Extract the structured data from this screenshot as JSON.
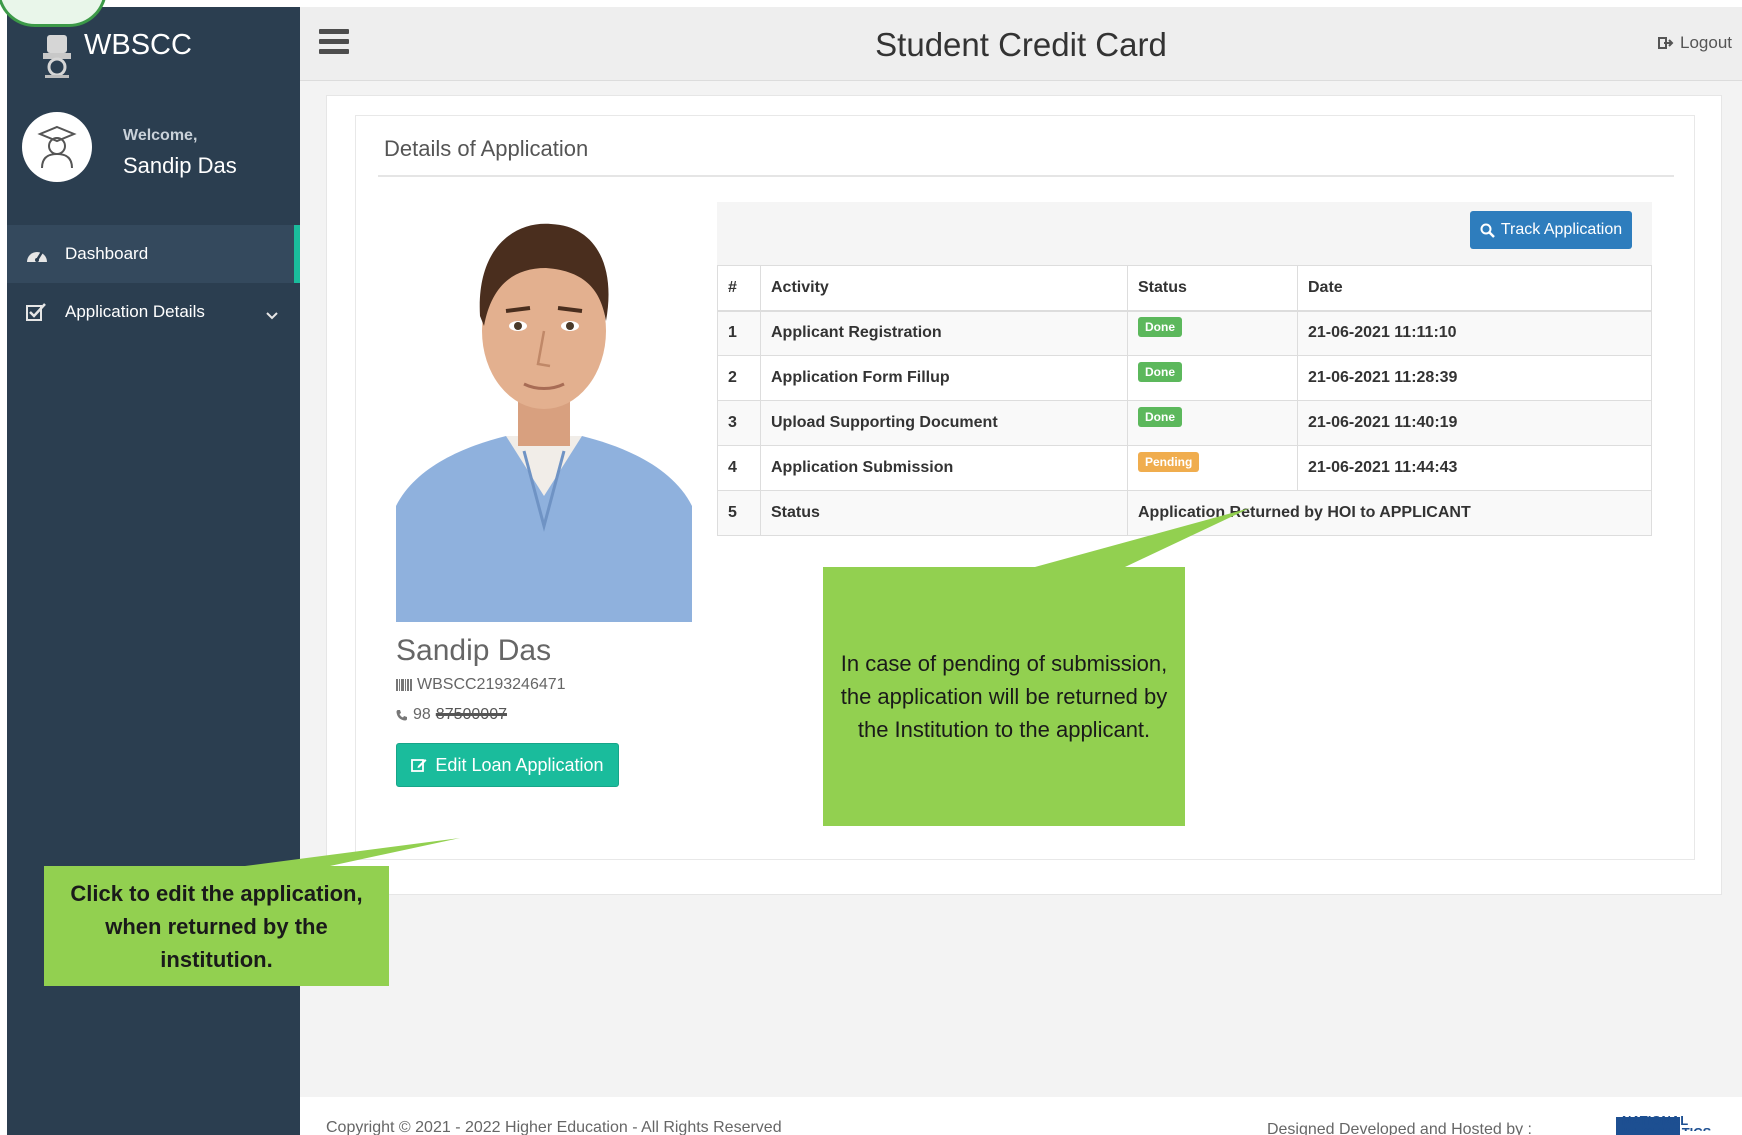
{
  "brand": {
    "name": "WBSCC"
  },
  "profile": {
    "welcome": "Welcome,",
    "name": "Sandip Das"
  },
  "nav": {
    "items": [
      {
        "label": "Dashboard",
        "icon": "dashboard-icon",
        "active": true
      },
      {
        "label": "Application Details",
        "icon": "checkbox-icon",
        "active": false
      }
    ]
  },
  "header": {
    "title": "Student Credit Card",
    "logout_label": "Logout"
  },
  "card": {
    "title": "Details of Application"
  },
  "applicant": {
    "name": "Sandip Das",
    "id": "WBSCC2193246471",
    "phone": "98",
    "phone_masked": "87500007",
    "edit_button": "Edit Loan Application"
  },
  "track_button": "Track Application",
  "table": {
    "headers": [
      "#",
      "Activity",
      "Status",
      "Date"
    ],
    "rows": [
      {
        "n": "1",
        "activity": "Applicant Registration",
        "status": "Done",
        "date": "21-06-2021 11:11:10"
      },
      {
        "n": "2",
        "activity": "Application Form Fillup",
        "status": "Done",
        "date": "21-06-2021 11:28:39"
      },
      {
        "n": "3",
        "activity": "Upload Supporting Document",
        "status": "Done",
        "date": "21-06-2021 11:40:19"
      },
      {
        "n": "4",
        "activity": "Application Submission",
        "status": "Pending",
        "date": "21-06-2021 11:44:43"
      }
    ],
    "status_row": {
      "n": "5",
      "activity": "Status",
      "value": "Application Returned by HOI to APPLICANT"
    }
  },
  "callouts": {
    "right": "In case of pending of submission, the application will be returned by the Institution to the applicant.",
    "left": "Click to edit the application, when returned by the institution."
  },
  "footer": {
    "copyright": "Copyright © 2021 - 2022 Higher Education - All Rights Reserved",
    "designed": "Designed Developed and Hosted by :",
    "nic": "NATIONAL INFORMATICS"
  },
  "colors": {
    "sidebar": "#2b3e50",
    "accent": "#1abc9c",
    "primary": "#2e7dbd",
    "done": "#5cb85c",
    "pending": "#f0ad4e",
    "callout": "#92d050"
  }
}
